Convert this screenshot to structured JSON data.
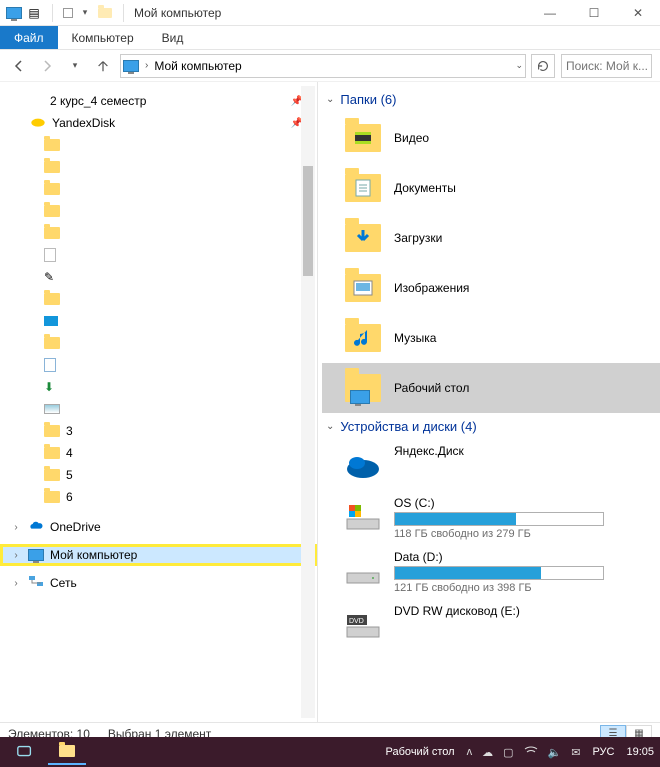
{
  "window": {
    "title": "Мой компьютер"
  },
  "ribbon": {
    "file": "Файл",
    "computer": "Компьютер",
    "view": "Вид"
  },
  "address": {
    "location": "Мой компьютер",
    "search_placeholder": "Поиск: Мой к..."
  },
  "nav": {
    "items": [
      {
        "label": "2 курс_4 семестр",
        "icon": "",
        "indent": 1,
        "pinned": true
      },
      {
        "label": "YandexDisk",
        "icon": "yadisk",
        "indent": 0,
        "pinned": true
      },
      {
        "label": "",
        "icon": "folder",
        "indent": 1
      },
      {
        "label": "",
        "icon": "folder",
        "indent": 1
      },
      {
        "label": "",
        "icon": "folder",
        "indent": 1
      },
      {
        "label": "",
        "icon": "folder",
        "indent": 1
      },
      {
        "label": "",
        "icon": "folder",
        "indent": 1
      },
      {
        "label": "",
        "icon": "doc",
        "indent": 1
      },
      {
        "label": "",
        "icon": "pencil",
        "indent": 1
      },
      {
        "label": "",
        "icon": "folder",
        "indent": 1
      },
      {
        "label": "",
        "icon": "monitor",
        "indent": 1
      },
      {
        "label": "",
        "icon": "folder",
        "indent": 1
      },
      {
        "label": "",
        "icon": "doc2",
        "indent": 1
      },
      {
        "label": "",
        "icon": "arrowdown",
        "indent": 1
      },
      {
        "label": "",
        "icon": "pic",
        "indent": 1
      },
      {
        "label": "3",
        "icon": "folder",
        "indent": 1
      },
      {
        "label": "4",
        "icon": "folder",
        "indent": 1
      },
      {
        "label": "5",
        "icon": "folder",
        "indent": 1
      },
      {
        "label": "6",
        "icon": "folder",
        "indent": 1
      }
    ],
    "onedrive": "OneDrive",
    "mycomputer": "Мой компьютер",
    "network": "Сеть"
  },
  "content": {
    "group_folders": "Папки (6)",
    "folders": [
      {
        "label": "Видео",
        "icon": "video"
      },
      {
        "label": "Документы",
        "icon": "docs"
      },
      {
        "label": "Загрузки",
        "icon": "downloads"
      },
      {
        "label": "Изображения",
        "icon": "images"
      },
      {
        "label": "Музыка",
        "icon": "music"
      },
      {
        "label": "Рабочий стол",
        "icon": "desktop",
        "selected": true
      }
    ],
    "group_drives": "Устройства и диски (4)",
    "drives": [
      {
        "name": "Яндекс.Диск",
        "type": "cloud"
      },
      {
        "name": "OS (C:)",
        "type": "hdd",
        "free": "118 ГБ свободно из 279 ГБ",
        "fill": 58
      },
      {
        "name": "Data (D:)",
        "type": "hdd",
        "free": "121 ГБ свободно из 398 ГБ",
        "fill": 70
      },
      {
        "name": "DVD RW дисковод (E:)",
        "type": "dvd"
      }
    ]
  },
  "statusbar": {
    "items": "Элементов: 10",
    "selected": "Выбран 1 элемент"
  },
  "taskbar": {
    "label": "Рабочий стол",
    "lang": "РУС",
    "time": "19:05"
  }
}
